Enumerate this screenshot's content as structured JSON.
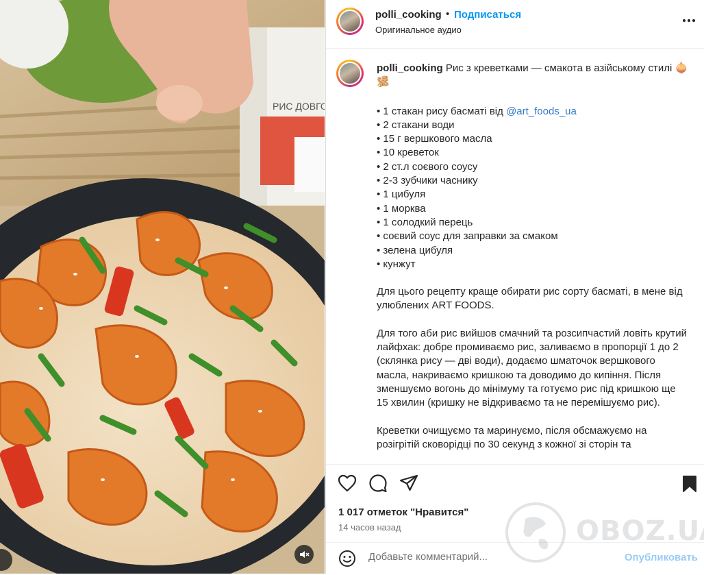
{
  "header": {
    "username": "polli_cooking",
    "separator": "•",
    "follow_label": "Подписаться",
    "audio_label": "Оригинальное аудио",
    "more_icon": "more-horizontal-icon"
  },
  "caption": {
    "username": "polli_cooking",
    "title": "Рис з креветками — смакота в азійському стилі 🧅🫚",
    "ingredients": [
      "• 1 стакан рису басматі від ",
      "• 2 стакани води",
      "• 15 г вершкового масла",
      "• 10 креветок",
      "• 2 ст.л соєвого соусу",
      "• 2-3 зубчики часнику",
      "• 1 цибуля",
      "• 1 морква",
      "• 1 солодкий перець",
      "• соєвий соус для заправки за смаком",
      "• зелена цибуля",
      "• кунжут"
    ],
    "mention": "@art_foods_ua",
    "paragraphs": [
      "Для цього рецепту краще обирати рис сорту басматі, в мене від улюблених ART FOODS.",
      "Для того аби рис вийшов смачний та розсипчастий ловіть крутий лайфхак: добре промиваємо рис, заливаємо в пропорції 1 до 2 (склянка рису — дві води), додаємо шматочок вершкового масла, накриваємо кришкою та доводимо до кипіння. Після зменшуємо вогонь до мінімуму та готуємо рис під кришкою ще 15 хвилин (кришку не відкриваємо та не перемішуємо рис).",
      "Креветки очищуємо та маринуємо, після обсмажуємо на розігрітій сковорідці по 30 секунд з кожної зі сторін та"
    ]
  },
  "actions": {
    "likes": "1 017 отметок \"Нравится\"",
    "time": "14 часов назад",
    "icons": [
      "heart-icon",
      "comment-icon",
      "share-icon",
      "bookmark-icon"
    ]
  },
  "comment": {
    "placeholder": "Добавьте комментарий...",
    "publish_label": "Опубликовать",
    "emoji_icon": "emoji-icon"
  },
  "media": {
    "package_label": "РИС ДОВГОЗЕР"
  },
  "watermark": {
    "text": "OBOZ.UA"
  },
  "colors": {
    "accent": "#0095f6",
    "publish_disabled": "#9ccbf5",
    "mention": "#3478c6"
  }
}
